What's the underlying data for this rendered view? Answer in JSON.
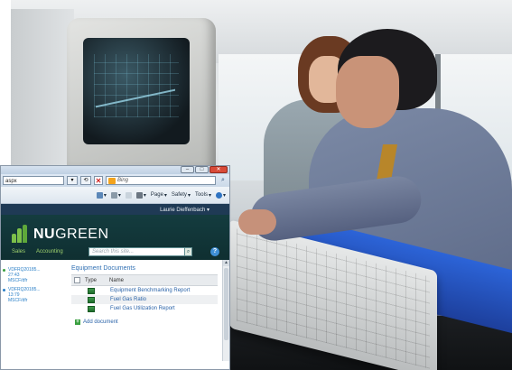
{
  "browser": {
    "window_buttons": {
      "minimize": "–",
      "maximize": "□",
      "close": "✕"
    },
    "address": {
      "url_text": "aspx",
      "refresh_symbol": "⟲",
      "stop_symbol": "✕",
      "search_engine": "Bing",
      "search_go_symbol": "⌕"
    },
    "command_bar": {
      "page_label": "Page",
      "safety_label": "Safety",
      "tools_label": "Tools",
      "dropdown_arrow": "▾"
    }
  },
  "sharepoint": {
    "user_name": "Laurie Dieffenbach ▾",
    "logo": {
      "part1": "NU",
      "part2": "GREEN"
    },
    "top_nav": [
      "Sales",
      "Accounting"
    ],
    "search_placeholder": "Search this site...",
    "search_button_symbol": "⌕",
    "help_symbol": "?",
    "left_nav": [
      {
        "line1": "VDFRQ20185...",
        "line2": "27:43",
        "line3": "MSCF/dfr",
        "color": "#3aa041"
      },
      {
        "line1": "VDFRQ20185...",
        "line2": "13:79",
        "line3": "MSCF/dfr",
        "color": "#2a7fc7"
      }
    ],
    "library": {
      "title": "Equipment Documents",
      "columns": {
        "type": "Type",
        "name": "Name"
      },
      "rows": [
        {
          "name": "Equipment Benchmarking Report"
        },
        {
          "name": "Fuel Gas Ratio"
        },
        {
          "name": "Fuel Gas Utilization Report"
        }
      ],
      "add_symbol": "+",
      "add_label": "Add document"
    },
    "scroll_up": "▲",
    "scroll_down": "▼"
  },
  "colors": {
    "brand_green": "#7cc04a",
    "header_bg": "#143c3f",
    "link_blue": "#2a63a8",
    "ie_close_red": "#d84a38"
  }
}
